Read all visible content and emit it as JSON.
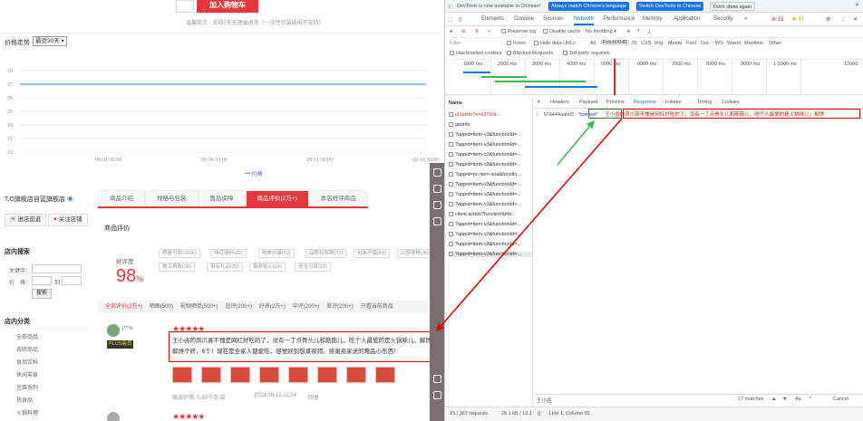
{
  "shop": {
    "buy_button": "加入购物车",
    "tip_text": "温馨提示 · 支持7天无理由退货（一次性包装破损不支持）",
    "price_trend_label": "价格走势",
    "price_select": "最近30天",
    "chart_data": {
      "type": "line",
      "x": [
        "09-01 00:00",
        "09-06 00:00",
        "09-11 00:00",
        "09-16 00:00"
      ],
      "series": [
        {
          "name": "价格",
          "values": [
            27,
            27,
            27,
            27
          ]
        }
      ],
      "ylim": [
        22,
        28
      ],
      "yticks": [
        "28",
        "27",
        "26",
        "25",
        "24",
        "23",
        "22"
      ],
      "legend": "价格",
      "colors": {
        "line": "#6ab0ff"
      }
    },
    "shop_name": "T.O旗舰店自营旗舰店",
    "enter_shop": "进店逛逛",
    "follow_shop": "关注店铺",
    "tabs": [
      "商品介绍",
      "规格与包装",
      "售后保障",
      "商品评价(2万+)",
      "本店好评商品"
    ],
    "section_title": "商品评价",
    "rate_label": "好评度",
    "rate_value": "98",
    "rate_unit": "%",
    "tags": [
      "质量可靠(1026)",
      "味道很好(82)",
      "物美价廉(63)",
      "品质有保障(77)",
      "包装不错(52)",
      "口感很棒(36)",
      "做工精致(30)",
      "带有礼品(29)",
      "服务贴心(24)",
      "安全可靠(21)"
    ],
    "filters": [
      "全部评价(2万+)",
      "晒图(500)",
      "视频晒单(500+)",
      "追评(200+)",
      "好评(2万+)",
      "中评(200+)",
      "差评(200+)",
      "只看当前商品"
    ],
    "left_search_title": "店内搜索",
    "kw_label": "关键字：",
    "price_label": "价　格：",
    "to_label": "到",
    "search_btn": "搜索",
    "cat_title": "店内分类",
    "categories": [
      "全部商品",
      "去除商品",
      "食品饮料",
      "休闲零食",
      "豆腐系列",
      "热食品",
      "火锅料理"
    ],
    "comment_user": "j***e",
    "comment_badge": "PLUS会员",
    "stars": "★★★★★",
    "comment_text": "王小卤的凤爪真不愧是网红好吃的了，没有一丁点骨头儿和筋筋儿，吃个人最爱的是火锅味儿，解馋解馋个好，6个！现在是全家人都爱吃，感觉好到想录视频。感谢卖家送的赠品小东西！",
    "comment_date": "微波炉热, 0.30千克/袋",
    "comment_time": "2023-09-12 11:34",
    "comment_reply": "回复"
  },
  "devtools": {
    "info_text": "DevTools is now available in Chinese!",
    "btn_match": "Always match Chrome's language",
    "btn_switch": "Switch DevTools to Chinese",
    "btn_dont": "Don't show again",
    "tabs": [
      "Elements",
      "Console",
      "Sources",
      "Network",
      "Performance",
      "Memory",
      "Application",
      "Security",
      "»"
    ],
    "active_tab": "Network",
    "badge_err": "18",
    "badge_warn": "11",
    "toolbar": {
      "preserve": "Preserve log",
      "disable_cache": "Disable cache",
      "throttle": "No throttling"
    },
    "filter": {
      "placeholder": "Filter",
      "invert": "Invert",
      "hide_data": "Hide data URLs",
      "types": [
        "All",
        "Fetch/XHR",
        "JS",
        "CSS",
        "Img",
        "Media",
        "Font",
        "Doc",
        "WS",
        "Wasm",
        "Manifest",
        "Other"
      ]
    },
    "checks": [
      "Has blocked cookies",
      "Blocked Requests",
      "3rd-party requests"
    ],
    "timeline_ticks": [
      "1000 ms",
      "2000 ms",
      "3000 ms",
      "4000 ms",
      "5000 ms",
      "6000 ms",
      "7000 ms",
      "8000 ms",
      "9000 ms",
      "1 0000 ms",
      "12000"
    ],
    "name_header": "Name",
    "requests": [
      "jd.bdsfn?e=z37UH...",
      "getinfo",
      "?appid=item-v3&functionId=...",
      "?appid=item-v3&functionId=...",
      "?appid=item-v3&functionId=...",
      "?appid=item-v3&functionId=...",
      "?appid=pc-item-soa&functio...",
      "?appid=item-v3&functionId=...",
      "?appid=item-v3&functionId=...",
      "?appid=item-v3&functionId=...",
      "client.action?functionId=b...",
      "?appid=item-v3&functionId=...",
      "?appid=item-v3&functionId=...",
      "?appid=item-v3&functionId=...",
      "?appid=item-v3&functionId=..."
    ],
    "detail_tabs": [
      "Headers",
      "Payload",
      "Preview",
      "Response",
      "Initiator",
      "Timing",
      "Cookies"
    ],
    "active_detail_tab": "Response",
    "resp_line_no": "1",
    "resp_prefix": "574444aab05",
    "resp_key": "\"content\"",
    "resp_value": "王小卤的凤爪真不愧是网红好吃的了，没有一丁点骨头儿和筋筋儿，吃个人最爱的是火锅味儿，解馋",
    "search_text": "王小卤",
    "search_matches": "17 matches",
    "cancel": "Cancel",
    "status_requests": "15 / 367 requests",
    "status_size": "25.1 kB / 12.1",
    "status_pos": "Line 1, Column 95"
  }
}
